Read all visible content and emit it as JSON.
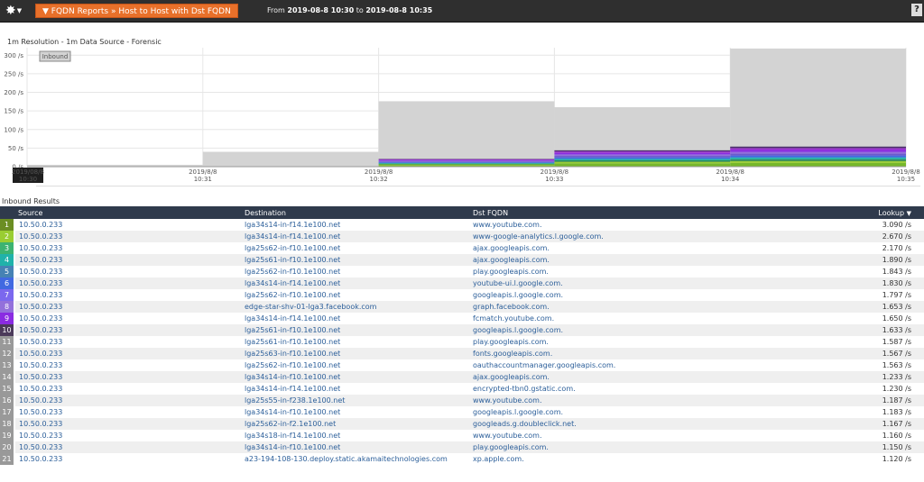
{
  "header": {
    "gear_caret": "▼",
    "breadcrumb": "▼ FQDN Reports » Host to Host with Dst FQDN",
    "from_label": "From",
    "from": "2019-08-8 10:30",
    "to_label": "to",
    "to": "2019-08-8 10:35",
    "help": "?"
  },
  "subtitle": "1m Resolution - 1m Data Source - Forensic",
  "colors": {
    "topbar": "#2f2f2f",
    "breadcrumb": "#e8702a",
    "table_header": "#2f3a4c",
    "link": "#2c5f9a",
    "area_total": "#d3d3d3"
  },
  "chart_data": {
    "type": "area",
    "legend": [
      "Inbound"
    ],
    "legend_position": "top-left",
    "y_ticks": [
      "300 /s",
      "250 /s",
      "200 /s",
      "150 /s",
      "100 /s",
      "50 /s",
      "0 /s"
    ],
    "ylim": [
      0,
      320
    ],
    "x_labels": [
      {
        "date": "2019/08/8",
        "time": "10:30",
        "highlight": true
      },
      {
        "date": "2019/8/8",
        "time": "10:31"
      },
      {
        "date": "2019/8/8",
        "time": "10:32"
      },
      {
        "date": "2019/8/8",
        "time": "10:33"
      },
      {
        "date": "2019/8/8",
        "time": "10:34"
      },
      {
        "date": "2019/8/8",
        "time": "10:35"
      }
    ],
    "total_series": {
      "name": "Inbound",
      "values": [
        5,
        40,
        176,
        160,
        318
      ]
    },
    "stacked_series": [
      {
        "color": "#76b82a",
        "values": [
          0,
          0,
          4,
          9,
          10
        ]
      },
      {
        "color": "#9acd32",
        "values": [
          0,
          0,
          2,
          4,
          5
        ]
      },
      {
        "color": "#2e8b57",
        "values": [
          0,
          0,
          2,
          4,
          5
        ]
      },
      {
        "color": "#20b2aa",
        "values": [
          0,
          0,
          2,
          4,
          5
        ]
      },
      {
        "color": "#4169e1",
        "values": [
          0,
          0,
          2,
          4,
          5
        ]
      },
      {
        "color": "#6a5acd",
        "values": [
          0,
          0,
          2,
          4,
          5
        ]
      },
      {
        "color": "#9370db",
        "values": [
          0,
          0,
          2,
          4,
          5
        ]
      },
      {
        "color": "#8a2be2",
        "values": [
          0,
          0,
          2,
          4,
          5
        ]
      },
      {
        "color": "#9932cc",
        "values": [
          0,
          0,
          2,
          4,
          5
        ]
      },
      {
        "color": "#4b2e6b",
        "values": [
          0,
          0,
          1,
          3,
          4
        ]
      }
    ]
  },
  "results": {
    "title": "Inbound Results",
    "columns": {
      "source": "Source",
      "destination": "Destination",
      "fqdn": "Dst FQDN",
      "lookup": "Lookup"
    },
    "sort_caret": "▼",
    "rows": [
      {
        "idx": "1",
        "color": "#6b8e23",
        "source": "10.50.0.233",
        "destination": "lga34s14-in-f14.1e100.net",
        "fqdn": "www.youtube.com.",
        "lookup": "3.090 /s"
      },
      {
        "idx": "2",
        "color": "#9acd32",
        "source": "10.50.0.233",
        "destination": "lga34s14-in-f14.1e100.net",
        "fqdn": "www-google-analytics.l.google.com.",
        "lookup": "2.670 /s"
      },
      {
        "idx": "3",
        "color": "#3cb371",
        "source": "10.50.0.233",
        "destination": "lga25s62-in-f10.1e100.net",
        "fqdn": "ajax.googleapis.com.",
        "lookup": "2.170 /s"
      },
      {
        "idx": "4",
        "color": "#20b2aa",
        "source": "10.50.0.233",
        "destination": "lga25s61-in-f10.1e100.net",
        "fqdn": "ajax.googleapis.com.",
        "lookup": "1.890 /s"
      },
      {
        "idx": "5",
        "color": "#4682b4",
        "source": "10.50.0.233",
        "destination": "lga25s62-in-f10.1e100.net",
        "fqdn": "play.googleapis.com.",
        "lookup": "1.843 /s"
      },
      {
        "idx": "6",
        "color": "#4169e1",
        "source": "10.50.0.233",
        "destination": "lga34s14-in-f14.1e100.net",
        "fqdn": "youtube-ui.l.google.com.",
        "lookup": "1.830 /s"
      },
      {
        "idx": "7",
        "color": "#7b68ee",
        "source": "10.50.0.233",
        "destination": "lga25s62-in-f10.1e100.net",
        "fqdn": "googleapis.l.google.com.",
        "lookup": "1.797 /s"
      },
      {
        "idx": "8",
        "color": "#9370db",
        "source": "10.50.0.233",
        "destination": "edge-star-shv-01-lga3.facebook.com",
        "fqdn": "graph.facebook.com.",
        "lookup": "1.653 /s"
      },
      {
        "idx": "9",
        "color": "#8a2be2",
        "source": "10.50.0.233",
        "destination": "lga34s14-in-f14.1e100.net",
        "fqdn": "fcmatch.youtube.com.",
        "lookup": "1.650 /s"
      },
      {
        "idx": "10",
        "color": "#4b3a5a",
        "source": "10.50.0.233",
        "destination": "lga25s61-in-f10.1e100.net",
        "fqdn": "googleapis.l.google.com.",
        "lookup": "1.633 /s"
      },
      {
        "idx": "11",
        "color": "#999999",
        "source": "10.50.0.233",
        "destination": "lga25s61-in-f10.1e100.net",
        "fqdn": "play.googleapis.com.",
        "lookup": "1.587 /s"
      },
      {
        "idx": "12",
        "color": "#999999",
        "source": "10.50.0.233",
        "destination": "lga25s63-in-f10.1e100.net",
        "fqdn": "fonts.googleapis.com.",
        "lookup": "1.567 /s"
      },
      {
        "idx": "13",
        "color": "#999999",
        "source": "10.50.0.233",
        "destination": "lga25s62-in-f10.1e100.net",
        "fqdn": "oauthaccountmanager.googleapis.com.",
        "lookup": "1.563 /s"
      },
      {
        "idx": "14",
        "color": "#999999",
        "source": "10.50.0.233",
        "destination": "lga34s14-in-f10.1e100.net",
        "fqdn": "ajax.googleapis.com.",
        "lookup": "1.233 /s"
      },
      {
        "idx": "15",
        "color": "#999999",
        "source": "10.50.0.233",
        "destination": "lga34s14-in-f14.1e100.net",
        "fqdn": "encrypted-tbn0.gstatic.com.",
        "lookup": "1.230 /s"
      },
      {
        "idx": "16",
        "color": "#999999",
        "source": "10.50.0.233",
        "destination": "lga25s55-in-f238.1e100.net",
        "fqdn": "www.youtube.com.",
        "lookup": "1.187 /s"
      },
      {
        "idx": "17",
        "color": "#999999",
        "source": "10.50.0.233",
        "destination": "lga34s14-in-f10.1e100.net",
        "fqdn": "googleapis.l.google.com.",
        "lookup": "1.183 /s"
      },
      {
        "idx": "18",
        "color": "#999999",
        "source": "10.50.0.233",
        "destination": "lga25s62-in-f2.1e100.net",
        "fqdn": "googleads.g.doubleclick.net.",
        "lookup": "1.167 /s"
      },
      {
        "idx": "19",
        "color": "#999999",
        "source": "10.50.0.233",
        "destination": "lga34s18-in-f14.1e100.net",
        "fqdn": "www.youtube.com.",
        "lookup": "1.160 /s"
      },
      {
        "idx": "20",
        "color": "#999999",
        "source": "10.50.0.233",
        "destination": "lga34s14-in-f10.1e100.net",
        "fqdn": "play.googleapis.com.",
        "lookup": "1.150 /s"
      },
      {
        "idx": "21",
        "color": "#999999",
        "source": "10.50.0.233",
        "destination": "a23-194-108-130.deploy.static.akamaitechnologies.com",
        "fqdn": "xp.apple.com.",
        "lookup": "1.120 /s"
      }
    ]
  }
}
